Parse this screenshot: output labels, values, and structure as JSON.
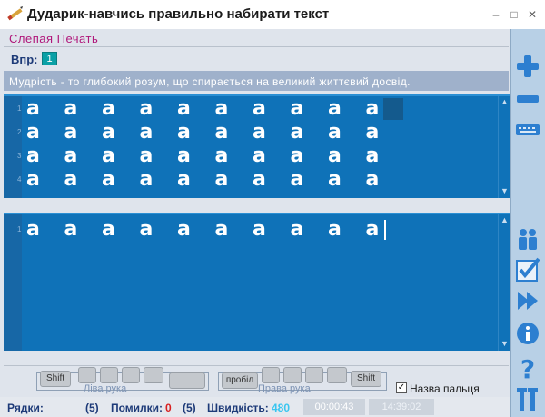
{
  "window": {
    "title": "Дударик-навчись правильно набирати текст",
    "minimize_glyph": "–",
    "restore_glyph": "□",
    "close_glyph": "✕"
  },
  "mode": {
    "label": "Слепая Печать"
  },
  "exercise": {
    "label": "Впр:",
    "number": "1"
  },
  "sentence": "Мудрість - то глибокий розум, що спирається на великий життєвий досвід.",
  "sample": {
    "line_numbers": [
      "1",
      "2",
      "3",
      "4"
    ],
    "lines": [
      [
        "a",
        "a",
        "a",
        "a",
        "a",
        "a",
        "a",
        "a",
        "a",
        "a"
      ],
      [
        "a",
        "a",
        "a",
        "a",
        "a",
        "a",
        "a",
        "a",
        "a",
        "a"
      ],
      [
        "a",
        "a",
        "a",
        "a",
        "a",
        "a",
        "a",
        "a",
        "a",
        "a"
      ],
      [
        "a",
        "a",
        "a",
        "a",
        "a",
        "a",
        "a",
        "a",
        "a",
        "a"
      ]
    ]
  },
  "typed": {
    "line_numbers": [
      "1"
    ],
    "lines": [
      [
        "a",
        "a",
        "a",
        "a",
        "a",
        "a",
        "a",
        "a",
        "a",
        "a"
      ]
    ]
  },
  "keyboard": {
    "left_hand_label": "Ліва рука",
    "right_hand_label": "Права рука",
    "shift_left": "Shift",
    "space": "пробіл",
    "shift_right": "Shift",
    "finger_name_label": "Назва пальця",
    "finger_name_checked": true
  },
  "status": {
    "rows_label": "Рядки:",
    "rows_value": "",
    "rows_total": "(5)",
    "errors_label": "Помилки:",
    "errors_value": "0",
    "errors_total": "(5)",
    "speed_label": "Швидкість:",
    "speed_value": "480",
    "elapsed": "00:00:43",
    "clock": "14:39:02"
  },
  "colors": {
    "panel": "#0f72b8",
    "accent_magenta": "#b0177a",
    "error_red": "#d81f1f",
    "speed_cyan": "#39c6f0"
  },
  "toolbar": {
    "buttons": [
      "plus-icon",
      "minus-icon",
      "keyboard-icon",
      "users-icon",
      "checklist-icon",
      "skip-icon",
      "info-icon",
      "help-icon",
      "tools-icon"
    ]
  }
}
